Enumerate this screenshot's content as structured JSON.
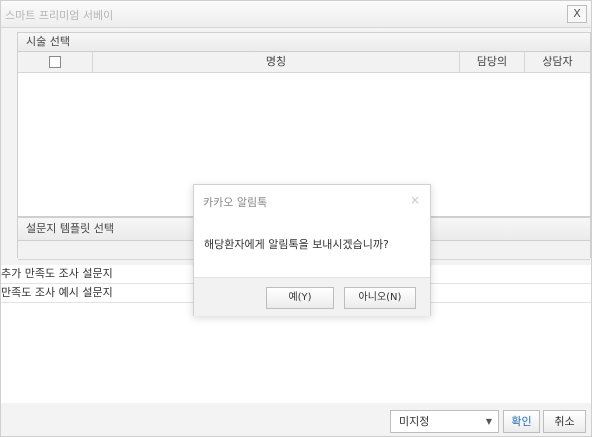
{
  "window": {
    "title": "스마트 프리미엄 서베이",
    "close_label": "X"
  },
  "procedure_section": {
    "header": "시술 선택",
    "columns": {
      "name": "명칭",
      "doctor": "담당의",
      "counselor": "상담자"
    }
  },
  "template_section": {
    "header": "설문지 템플릿 선택",
    "items": [
      "추가 만족도 조사 설문지",
      "만족도 조사 예시 설문지"
    ]
  },
  "footer": {
    "select_value": "미지정",
    "confirm_label": "확인",
    "cancel_label": "취소"
  },
  "dialog": {
    "title": "카카오 알림톡",
    "close_label": "×",
    "message": "해당환자에게 알림톡을 보내시겠습니까?",
    "yes_label": "예(Y)",
    "no_label": "아니오(N)"
  }
}
